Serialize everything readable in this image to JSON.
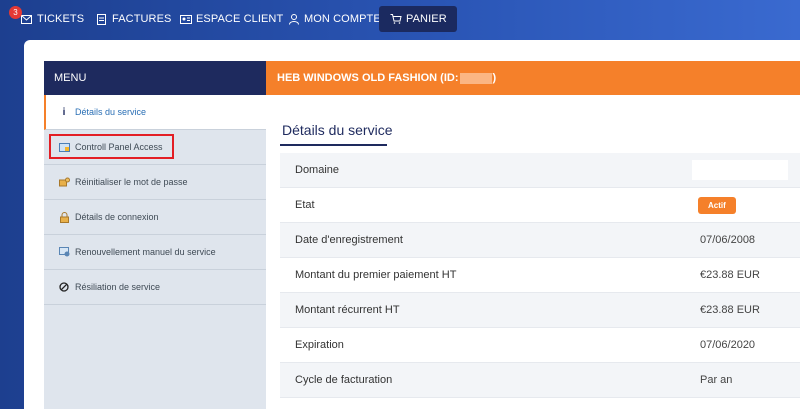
{
  "nav": {
    "badge_count": "3",
    "items": [
      {
        "label": "TICKETS",
        "icon": "mail-icon"
      },
      {
        "label": "FACTURES",
        "icon": "invoice-icon"
      },
      {
        "label": "ESPACE CLIENT",
        "icon": "id-card-icon"
      },
      {
        "label": "MON COMPTE",
        "icon": "user-icon"
      },
      {
        "label": "PANIER",
        "icon": "cart-icon"
      }
    ]
  },
  "sidebar": {
    "title": "MENU",
    "items": [
      {
        "label": "Détails du service",
        "icon": "info-icon"
      },
      {
        "label": "Controll Panel Access",
        "icon": "control-panel-icon"
      },
      {
        "label": "Réinitialiser le mot de passe",
        "icon": "key-reset-icon"
      },
      {
        "label": "Détails de connexion",
        "icon": "lock-icon"
      },
      {
        "label": "Renouvellement manuel du service",
        "icon": "renew-icon"
      },
      {
        "label": "Résiliation de service",
        "icon": "ban-icon"
      }
    ]
  },
  "header": {
    "title_prefix": "HEB WINDOWS OLD FASHION (ID:",
    "title_suffix": ")"
  },
  "main": {
    "section_title": "Détails du service",
    "rows": [
      {
        "label": "Domaine",
        "value": ""
      },
      {
        "label": "Etat",
        "value": "Actif"
      },
      {
        "label": "Date d'enregistrement",
        "value": "07/06/2008"
      },
      {
        "label": "Montant du premier paiement HT",
        "value": "€23.88 EUR"
      },
      {
        "label": "Montant récurrent HT",
        "value": "€23.88 EUR"
      },
      {
        "label": "Expiration",
        "value": "07/06/2020"
      },
      {
        "label": "Cycle de facturation",
        "value": "Par an"
      }
    ]
  },
  "colors": {
    "accent": "#f5802a",
    "navy": "#1e2a5e",
    "highlight": "#e31e24"
  }
}
